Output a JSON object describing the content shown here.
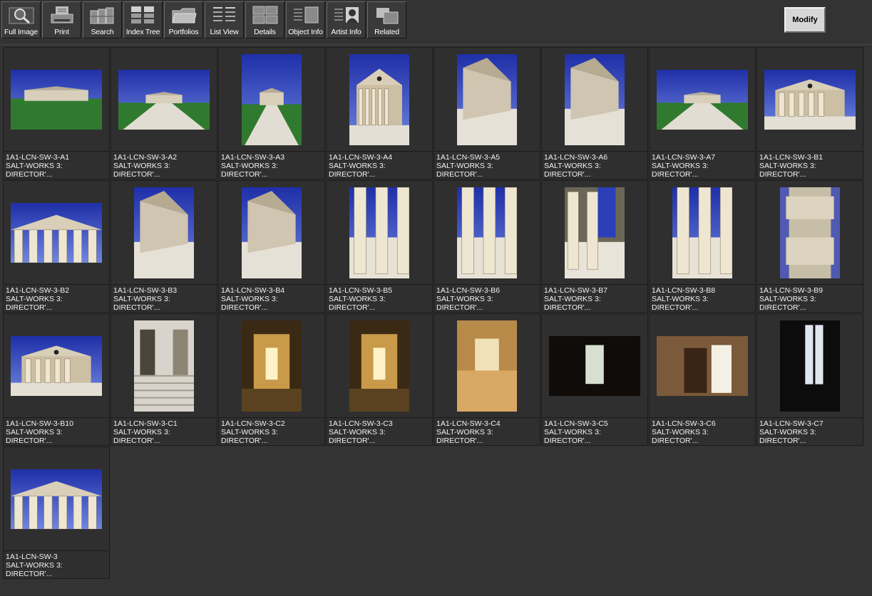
{
  "toolbar": [
    {
      "label": "Full Image",
      "icon": "magnifier-icon"
    },
    {
      "label": "Print",
      "icon": "printer-icon"
    },
    {
      "label": "Search",
      "icon": "search-cabinet-icon"
    },
    {
      "label": "Index Tree",
      "icon": "index-tree-icon"
    },
    {
      "label": "Portfolios",
      "icon": "folder-icon"
    },
    {
      "label": "List View",
      "icon": "list-view-icon"
    },
    {
      "label": "Details",
      "icon": "details-grid-icon"
    },
    {
      "label": "Object Info",
      "icon": "object-info-icon"
    },
    {
      "label": "Artist  Info",
      "icon": "artist-info-icon"
    },
    {
      "label": "Related",
      "icon": "related-squares-icon"
    }
  ],
  "modify_label": "Modify",
  "colors": {
    "background": "#333333",
    "tile": "#2f2f2f",
    "button": "#d7d7d7",
    "sky": "#2a3fb8",
    "grass": "#2f7a2f",
    "stone": "#c8c0ac"
  },
  "thumbnails": [
    {
      "id": "1A1-LCN-SW-3-A1",
      "title": "SALT-WORKS 3:",
      "subtitle": "DIRECTOR'...",
      "orientation": "landscape",
      "scene": "exterior-lawn"
    },
    {
      "id": "1A1-LCN-SW-3-A2",
      "title": "SALT-WORKS 3:",
      "subtitle": "DIRECTOR'...",
      "orientation": "landscape",
      "scene": "exterior-path"
    },
    {
      "id": "1A1-LCN-SW-3-A3",
      "title": "SALT-WORKS 3:",
      "subtitle": "DIRECTOR'...",
      "orientation": "portrait",
      "scene": "exterior-path"
    },
    {
      "id": "1A1-LCN-SW-3-A4",
      "title": "SALT-WORKS 3:",
      "subtitle": "DIRECTOR'...",
      "orientation": "portrait",
      "scene": "portico"
    },
    {
      "id": "1A1-LCN-SW-3-A5",
      "title": "SALT-WORKS 3:",
      "subtitle": "DIRECTOR'...",
      "orientation": "portrait",
      "scene": "wall-angle"
    },
    {
      "id": "1A1-LCN-SW-3-A6",
      "title": "SALT-WORKS 3:",
      "subtitle": "DIRECTOR'...",
      "orientation": "portrait",
      "scene": "wall-angle"
    },
    {
      "id": "1A1-LCN-SW-3-A7",
      "title": "SALT-WORKS 3:",
      "subtitle": "DIRECTOR'...",
      "orientation": "landscape",
      "scene": "exterior-courtyard"
    },
    {
      "id": "1A1-LCN-SW-3-B1",
      "title": "SALT-WORKS 3:",
      "subtitle": "DIRECTOR'...",
      "orientation": "landscape",
      "scene": "portico"
    },
    {
      "id": "1A1-LCN-SW-3-B2",
      "title": "SALT-WORKS 3:",
      "subtitle": "DIRECTOR'...",
      "orientation": "landscape",
      "scene": "pediment-columns"
    },
    {
      "id": "1A1-LCN-SW-3-B3",
      "title": "SALT-WORKS 3:",
      "subtitle": "DIRECTOR'...",
      "orientation": "portrait",
      "scene": "wall-angle"
    },
    {
      "id": "1A1-LCN-SW-3-B4",
      "title": "SALT-WORKS 3:",
      "subtitle": "DIRECTOR'...",
      "orientation": "portrait",
      "scene": "wall-angle"
    },
    {
      "id": "1A1-LCN-SW-3-B5",
      "title": "SALT-WORKS 3:",
      "subtitle": "DIRECTOR'...",
      "orientation": "portrait",
      "scene": "columns-closeup"
    },
    {
      "id": "1A1-LCN-SW-3-B6",
      "title": "SALT-WORKS 3:",
      "subtitle": "DIRECTOR'...",
      "orientation": "portrait",
      "scene": "columns-closeup"
    },
    {
      "id": "1A1-LCN-SW-3-B7",
      "title": "SALT-WORKS 3:",
      "subtitle": "DIRECTOR'...",
      "orientation": "portrait",
      "scene": "colonnade"
    },
    {
      "id": "1A1-LCN-SW-3-B8",
      "title": "SALT-WORKS 3:",
      "subtitle": "DIRECTOR'...",
      "orientation": "portrait",
      "scene": "columns-closeup"
    },
    {
      "id": "1A1-LCN-SW-3-B9",
      "title": "SALT-WORKS 3:",
      "subtitle": "DIRECTOR'...",
      "orientation": "portrait",
      "scene": "stone-blocks"
    },
    {
      "id": "1A1-LCN-SW-3-B10",
      "title": "SALT-WORKS 3:",
      "subtitle": "DIRECTOR'...",
      "orientation": "landscape",
      "scene": "pediment"
    },
    {
      "id": "1A1-LCN-SW-3-C1",
      "title": "SALT-WORKS 3:",
      "subtitle": "DIRECTOR'...",
      "orientation": "portrait",
      "scene": "interior-stairs"
    },
    {
      "id": "1A1-LCN-SW-3-C2",
      "title": "SALT-WORKS 3:",
      "subtitle": "DIRECTOR'...",
      "orientation": "portrait",
      "scene": "interior-lit"
    },
    {
      "id": "1A1-LCN-SW-3-C3",
      "title": "SALT-WORKS 3:",
      "subtitle": "DIRECTOR'...",
      "orientation": "portrait",
      "scene": "interior-lit"
    },
    {
      "id": "1A1-LCN-SW-3-C4",
      "title": "SALT-WORKS 3:",
      "subtitle": "DIRECTOR'...",
      "orientation": "portrait",
      "scene": "interior-hall"
    },
    {
      "id": "1A1-LCN-SW-3-C5",
      "title": "SALT-WORKS 3:",
      "subtitle": "DIRECTOR'...",
      "orientation": "landscape",
      "scene": "dark-doorway"
    },
    {
      "id": "1A1-LCN-SW-3-C6",
      "title": "SALT-WORKS 3:",
      "subtitle": "DIRECTOR'...",
      "orientation": "landscape",
      "scene": "interior-doorway"
    },
    {
      "id": "1A1-LCN-SW-3-C7",
      "title": "SALT-WORKS 3:",
      "subtitle": "DIRECTOR'...",
      "orientation": "portrait",
      "scene": "dark-window"
    },
    {
      "id": "1A1-LCN-SW-3",
      "title": "SALT-WORKS 3:",
      "subtitle": "DIRECTOR'...",
      "orientation": "landscape",
      "scene": "pediment-columns"
    }
  ]
}
